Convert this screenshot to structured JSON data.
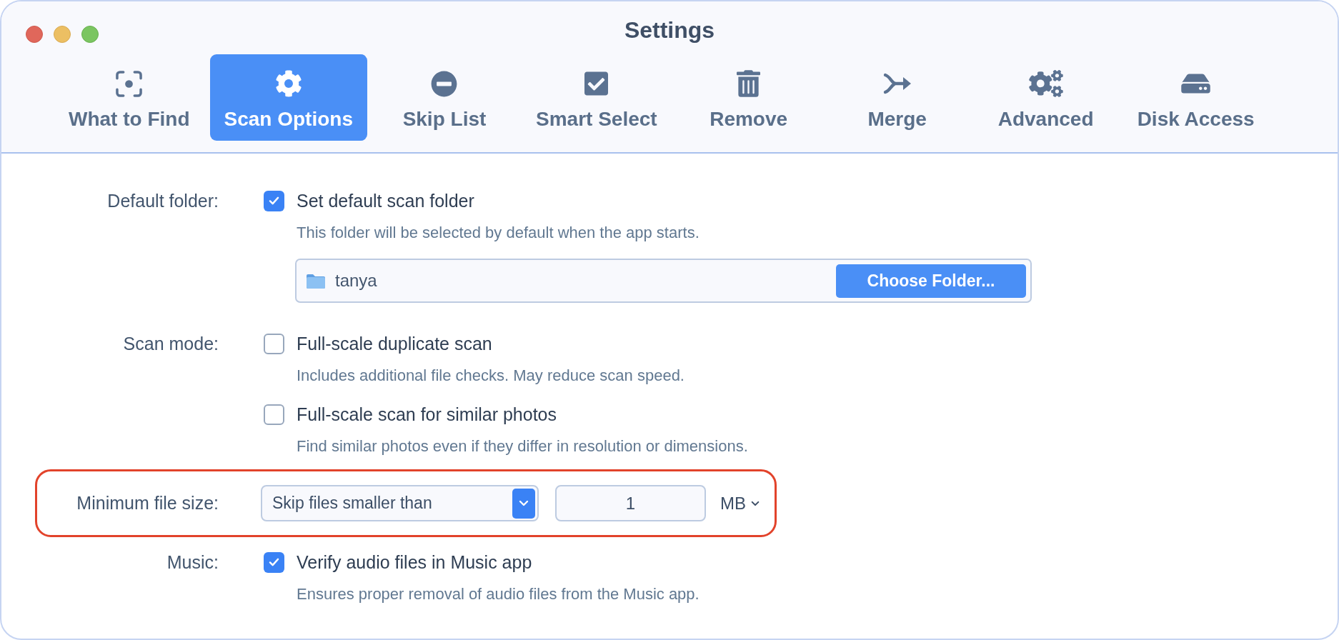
{
  "window": {
    "title": "Settings"
  },
  "tabs": [
    {
      "label": "What to Find",
      "selected": false
    },
    {
      "label": "Scan Options",
      "selected": true
    },
    {
      "label": "Skip List",
      "selected": false
    },
    {
      "label": "Smart Select",
      "selected": false
    },
    {
      "label": "Remove",
      "selected": false
    },
    {
      "label": "Merge",
      "selected": false
    },
    {
      "label": "Advanced",
      "selected": false
    },
    {
      "label": "Disk Access",
      "selected": false
    }
  ],
  "sections": [
    {
      "label": "Default folder:",
      "highlighted": false,
      "items": [
        {
          "kind": "checkbox",
          "label": "Set default scan folder",
          "checked": true,
          "description": "This folder will be selected by default when the app starts."
        },
        {
          "kind": "folder",
          "value": "tanya",
          "button": "Choose Folder..."
        }
      ]
    },
    {
      "label": "Scan mode:",
      "highlighted": false,
      "items": [
        {
          "kind": "checkbox",
          "label": "Full-scale duplicate scan",
          "checked": false,
          "description": "Includes additional file checks. May reduce scan speed."
        },
        {
          "kind": "checkbox",
          "label": "Full-scale scan for similar photos",
          "checked": false,
          "description": "Find similar photos even if they differ in resolution or dimensions."
        }
      ]
    },
    {
      "label": "Minimum file size:",
      "highlighted": true,
      "items": [
        {
          "kind": "size",
          "dropdown": "Skip files smaller than",
          "value": "1",
          "unit": "MB"
        }
      ]
    },
    {
      "label": "Music:",
      "highlighted": false,
      "items": [
        {
          "kind": "checkbox",
          "label": "Verify audio files in Music app",
          "checked": true,
          "description": "Ensures proper removal of audio files from the Music app."
        }
      ]
    }
  ]
}
